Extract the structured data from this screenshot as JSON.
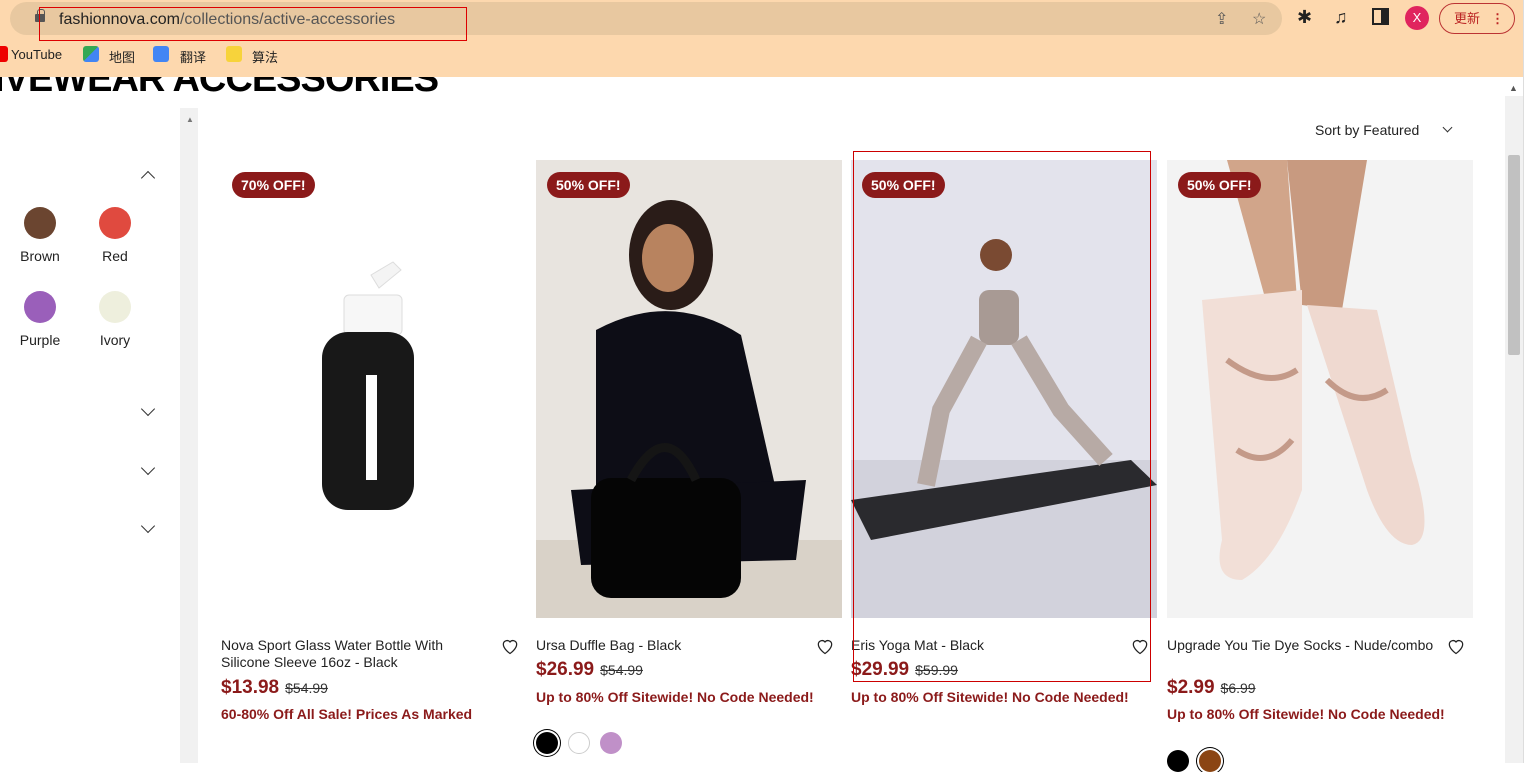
{
  "browser": {
    "url_host": "fashionnova.com",
    "url_path": "/collections/active-accessories",
    "avatar_letter": "X",
    "update_label": "更新",
    "bookmarks": [
      "YouTube",
      "地图",
      "翻译",
      "算法"
    ]
  },
  "page": {
    "title": "IVEWEAR ACCESSORIES",
    "sort_label": "Sort by Featured"
  },
  "filters": {
    "colors": [
      {
        "label": "Brown",
        "hex": "#6b4530"
      },
      {
        "label": "Red",
        "hex": "#e04a3f"
      },
      {
        "label": "Purple",
        "hex": "#9a5fba"
      },
      {
        "label": "Ivory",
        "hex": "#eeefdd"
      }
    ]
  },
  "products": [
    {
      "badge": "70% OFF!",
      "name": "Nova Sport Glass Water Bottle With Silicone Sleeve 16oz - Black",
      "price": "$13.98",
      "old_price": "$54.99",
      "promo": "60-80% Off All Sale! Prices As Marked",
      "swatches": []
    },
    {
      "badge": "50% OFF!",
      "name": "Ursa Duffle Bag - Black",
      "price": "$26.99",
      "old_price": "$54.99",
      "promo": "Up to 80% Off Sitewide! No Code Needed!",
      "swatches": [
        "#000000",
        "#ffffff",
        "#c090c8"
      ]
    },
    {
      "badge": "50% OFF!",
      "name": "Eris Yoga Mat - Black",
      "price": "$29.99",
      "old_price": "$59.99",
      "promo": "Up to 80% Off Sitewide! No Code Needed!",
      "swatches": []
    },
    {
      "badge": "50% OFF!",
      "name": "Upgrade You Tie Dye Socks - Nude/combo",
      "price": "$2.99",
      "old_price": "$6.99",
      "promo": "Up to 80% Off Sitewide! No Code Needed!",
      "swatches": [
        "#000000",
        "#8b4513"
      ]
    }
  ],
  "colors": {
    "accent": "#8b1a1a",
    "chrome": "#fdd8ae"
  }
}
